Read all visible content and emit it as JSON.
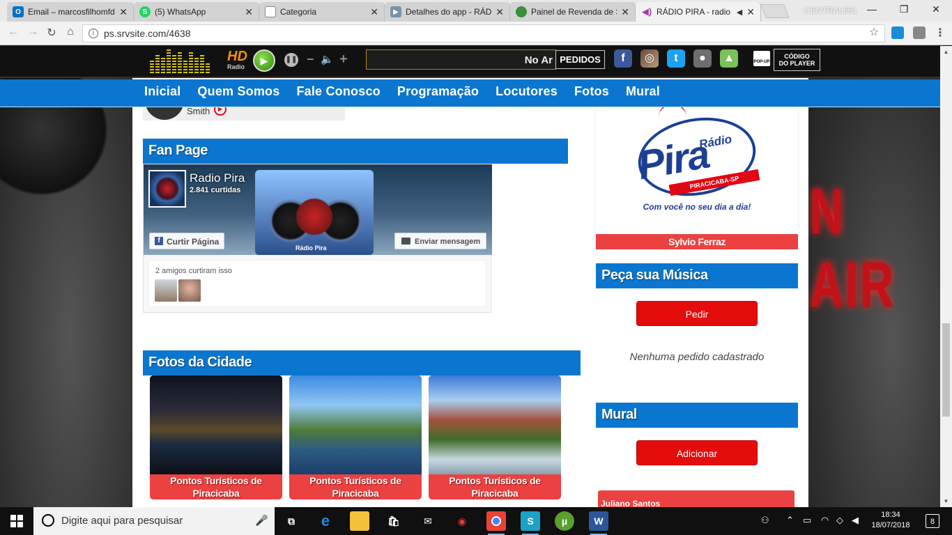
{
  "browser": {
    "tabs": [
      {
        "label": "Email – marcosfilhomfd",
        "favicon": "outlook-icon",
        "color": "#0072c6"
      },
      {
        "label": "(5) WhatsApp",
        "favicon": "whatsapp-icon",
        "color": "#25d366"
      },
      {
        "label": "Categoria",
        "favicon": "page-icon",
        "color": "#ffffff"
      },
      {
        "label": "Detalhes do app - RÁDIO",
        "favicon": "play-store-icon",
        "color": "#7a92a8"
      },
      {
        "label": "Painel de Revenda de S",
        "favicon": "globe-icon",
        "color": "#3a8f3a"
      },
      {
        "label": "RÁDIO PIRA - radio",
        "favicon": "audio-icon",
        "color": "#a53aa5",
        "active": true
      }
    ],
    "profile_name": "CENTRAL661",
    "url": "ps.srvsite.com/4638"
  },
  "player": {
    "hd_label": "HD",
    "radio_label": "Radio",
    "ticker_text": "No Ar",
    "pedidos_label": "PEDIDOS",
    "popup_label": "POP-UP",
    "codigo_label_1": "CÓDIGO",
    "codigo_label_2": "DO PLAYER",
    "social": [
      {
        "name": "facebook-icon",
        "glyph": "f",
        "color": "#3b5998"
      },
      {
        "name": "instagram-icon",
        "glyph": "◎",
        "color": "#8a3ab9"
      },
      {
        "name": "twitter-icon",
        "glyph": "t",
        "color": "#1da1f2"
      },
      {
        "name": "apple-icon",
        "glyph": "",
        "color": "#7d7d7d"
      },
      {
        "name": "android-icon",
        "glyph": "A",
        "color": "#78c257"
      }
    ]
  },
  "nav": {
    "items": [
      "Inicial",
      "Quem Somos",
      "Fale Conosco",
      "Programação",
      "Locutores",
      "Fotos",
      "Mural"
    ]
  },
  "top_show": {
    "host_name": "Smith"
  },
  "fan_page": {
    "title": "Fan Page",
    "page_name": "Radio Pira",
    "likes": "2.841 curtidas",
    "art_label": "Rádio Pira",
    "like_button": "Curtir Página",
    "message_button": "Enviar mensagem",
    "friends_text": "2 amigos curtiram isso"
  },
  "photos": {
    "title": "Fotos da Cidade",
    "items": [
      {
        "caption": "Pontos Turísticos de Piracicaba"
      },
      {
        "caption": "Pontos Turísticos de Piracicaba"
      },
      {
        "caption": "Pontos Turísticos de Piracicaba"
      }
    ]
  },
  "right": {
    "logo_word": "Pira",
    "logo_small": "Rádio",
    "logo_city": "PIRACICABA-SP",
    "logo_tagline": "Com você no seu dia a dia!",
    "announcer": "Sylvio Ferraz",
    "request_title": "Peça sua Música",
    "request_button": "Pedir",
    "no_requests": "Nenhuma pedido cadastrado",
    "mural_title": "Mural",
    "mural_button": "Adicionar",
    "mural_entry": "Juliano Santos"
  },
  "background": {
    "sign_text": "N AIR"
  },
  "taskbar": {
    "search_placeholder": "Digite aqui para pesquisar",
    "time": "18:34",
    "date": "18/07/2018",
    "notifications": "8"
  }
}
